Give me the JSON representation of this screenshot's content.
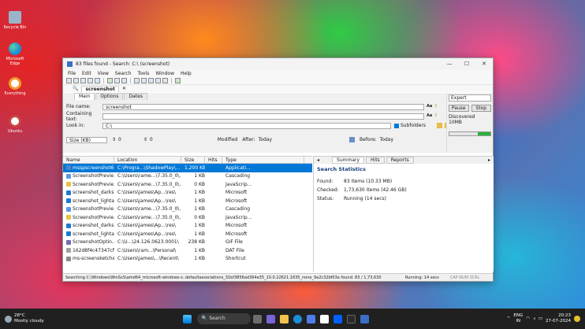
{
  "desktop": {
    "icons": [
      {
        "label": "Recycle Bin",
        "color": "#9bb4cc"
      },
      {
        "label": "Microsoft Edge",
        "color": "#1c8ed8"
      },
      {
        "label": "Everything",
        "color": "#f39a2a"
      },
      {
        "label": "Ubuntu",
        "color": "#c94545"
      }
    ]
  },
  "window": {
    "title": "83 files found - Search: C:\\ (screenshot)",
    "controls": {
      "min": "—",
      "max": "☐",
      "close": "✕"
    },
    "menu": [
      "File",
      "Edit",
      "View",
      "Search",
      "Tools",
      "Window",
      "Help"
    ],
    "doc_tab": "screenshot"
  },
  "form": {
    "subtabs": [
      "Main",
      "Options",
      "Dates"
    ],
    "file_name_label": "File name:",
    "file_name_value": "screenshot",
    "containing_text_label": "Containing text:",
    "containing_text_value": "",
    "look_in_label": "Look in:",
    "look_in_value": "C:\\",
    "subfolders_label": "Subfolders",
    "size_label": "Size (KB)",
    "size_from": "0",
    "size_to": "0",
    "modified_label": "Modified",
    "after_label": "After:",
    "after_value": "Today",
    "before_label": "Before:",
    "before_value": "Today"
  },
  "right_panel": {
    "mode": "Expert",
    "pause": "Pause",
    "stop": "Stop",
    "discovered_label": "Discovered",
    "discovered_value": "10MB",
    "progress": 1.0
  },
  "results": {
    "columns": [
      "Name",
      "Location",
      "Size",
      "Hits",
      "Type"
    ],
    "rows": [
      {
        "name": "msspscreenshot6...",
        "location": "C:\\Progra...\\ShadowPlay\\...",
        "size": "1,200 KB",
        "hits": "",
        "type": "Applicati...",
        "icon": "#4a86c8"
      },
      {
        "name": "ScreenshotPrevie...",
        "location": "C:\\Users\\rame...\\7.35.0_0\\...",
        "size": "1 KB",
        "hits": "",
        "type": "Cascading",
        "icon": "#5a9be0"
      },
      {
        "name": "ScreenshotPrevie...",
        "location": "C:\\Users\\rame...\\7.35.0_0\\...",
        "size": "0 KB",
        "hits": "",
        "type": "JavaScrip...",
        "icon": "#e7c243"
      },
      {
        "name": "screenshot_darks...",
        "location": "C:\\Users\\james\\Ap...\\res\\",
        "size": "1 KB",
        "hits": "",
        "type": "Microsoft",
        "icon": "#1c7bd0"
      },
      {
        "name": "screenshot_lighta...",
        "location": "C:\\Users\\james\\Ap...\\res\\",
        "size": "1 KB",
        "hits": "",
        "type": "Microsoft",
        "icon": "#1c7bd0"
      },
      {
        "name": "ScreenshotPrevie...",
        "location": "C:\\Users\\rame...\\7.35.0_0\\...",
        "size": "1 KB",
        "hits": "",
        "type": "Cascading",
        "icon": "#5a9be0"
      },
      {
        "name": "ScreenshotPrevie...",
        "location": "C:\\Users\\rame...\\7.35.0_0\\...",
        "size": "0 KB",
        "hits": "",
        "type": "JavaScrip...",
        "icon": "#e7c243"
      },
      {
        "name": "screenshot_darks...",
        "location": "C:\\Users\\james\\Ap...\\res\\",
        "size": "1 KB",
        "hits": "",
        "type": "Microsoft",
        "icon": "#1c7bd0"
      },
      {
        "name": "screenshot_lighta...",
        "location": "C:\\Users\\james\\Ap...\\res\\",
        "size": "1 KB",
        "hits": "",
        "type": "Microsoft",
        "icon": "#1c7bd0"
      },
      {
        "name": "ScreenshotOptin...",
        "location": "C:\\U...\\24.126.0623.0001\\",
        "size": "238 KB",
        "hits": "",
        "type": "GIF File",
        "icon": "#7b68b5"
      },
      {
        "name": "162d8f4c47347cf...",
        "location": "C:\\Users\\ram...\\Personal\\",
        "size": "1 KB",
        "hits": "",
        "type": "DAT File",
        "icon": "#a0a0a0"
      },
      {
        "name": "ms-screensketche...",
        "location": "C:\\Users\\james\\...\\Recent\\",
        "size": "1 KB",
        "hits": "",
        "type": "Shortcut",
        "icon": "#8b8b8b"
      }
    ]
  },
  "stats": {
    "tabs": [
      "Summary",
      "Hits",
      "Reports"
    ],
    "heading": "Search Statistics",
    "found_label": "Found:",
    "found_value": "83 items (10.33 MB)",
    "checked_label": "Checked:",
    "checked_value": "1,73,630 items (42.46 GB)",
    "status_label": "Status:",
    "status_value": "Running (14 secs)"
  },
  "statusbar": {
    "text": "Searching C:\\Windows\\WinSxS\\amd64_microsoft-windows-s..defaultassociations_31bf3856ad364e35_10.0.22621.1635_none_9a2c32bf03a  found: 83 / 1,73,630",
    "running": "Running: 14 secs",
    "keys": "CAP NUM SCRL"
  },
  "taskbar": {
    "weather_temp": "28°C",
    "weather_desc": "Mostly cloudy",
    "search_placeholder": "Search",
    "lang": "ENG",
    "region": "IN",
    "time": "20:23",
    "date": "27-07-2024"
  }
}
